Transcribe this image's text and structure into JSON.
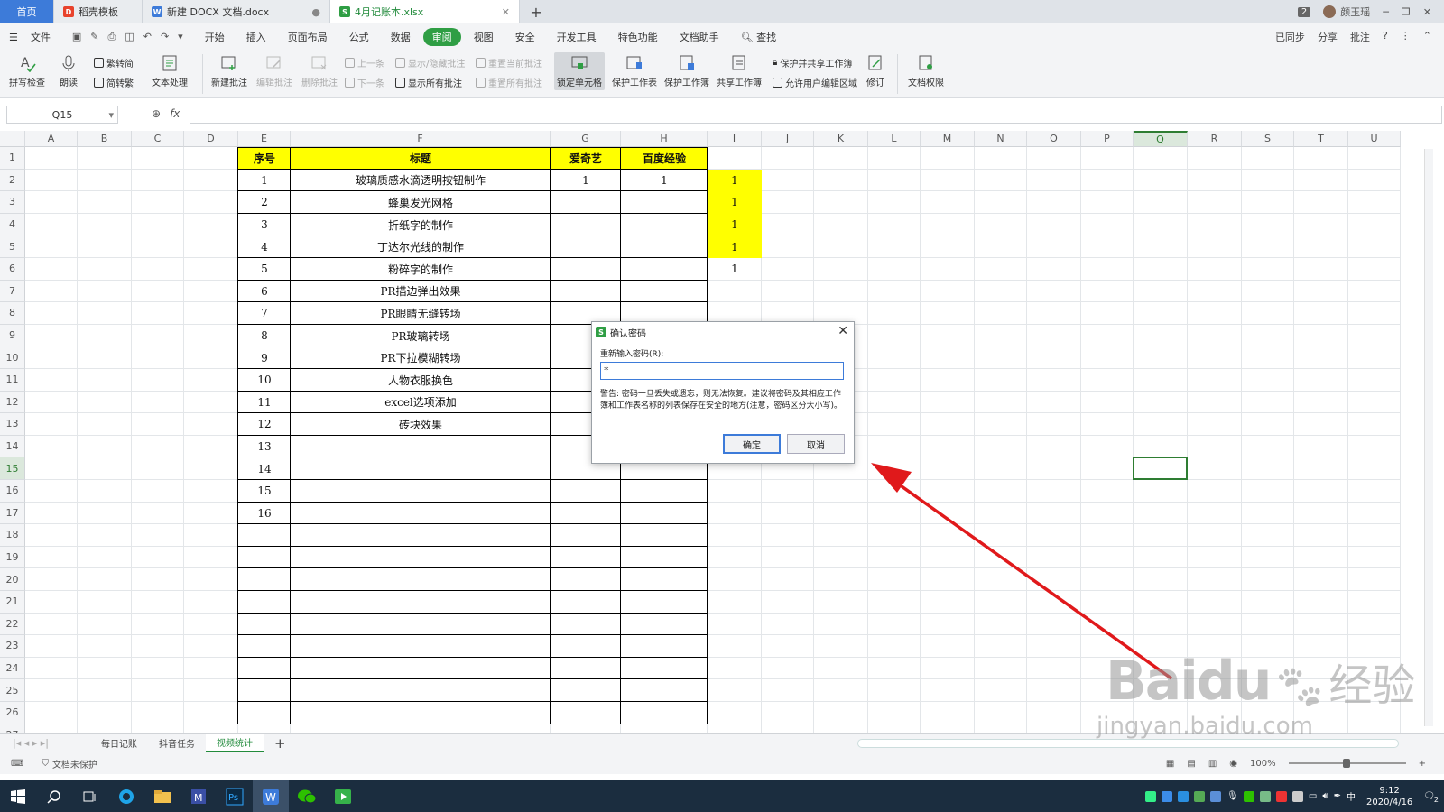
{
  "tabs": {
    "home": "首页",
    "items": [
      {
        "label": "稻壳模板"
      },
      {
        "label": "新建 DOCX 文档.docx"
      },
      {
        "label": "4月记账本.xlsx"
      }
    ],
    "badge": "2",
    "user": "颜玉瑶"
  },
  "menu": {
    "file": "文件",
    "items": [
      "开始",
      "插入",
      "页面布局",
      "公式",
      "数据",
      "审阅",
      "视图",
      "安全",
      "开发工具",
      "特色功能",
      "文档助手"
    ],
    "search": "查找",
    "right": [
      "已同步",
      "分享",
      "批注"
    ]
  },
  "ribbon": {
    "spell": "拼写检查",
    "read": "朗读",
    "trad": "繁转简",
    "simp": "简转繁",
    "textproc": "文本处理",
    "newcomment": "新建批注",
    "editcomment": "编辑批注",
    "delcomment": "删除批注",
    "prev": "上一条",
    "next": "下一条",
    "showhide": "显示/隐藏批注",
    "showall": "显示所有批注",
    "resetcur": "重置当前批注",
    "resetall": "重置所有批注",
    "lockcell": "锁定单元格",
    "protectsheet": "保护工作表",
    "protectbook": "保护工作簿",
    "sharebook": "共享工作簿",
    "protectshare": "保护并共享工作簿",
    "allowedit": "允许用户编辑区域",
    "revise": "修订",
    "docperm": "文档权限"
  },
  "formula": {
    "namebox": "Q15",
    "fx": "fx",
    "value": ""
  },
  "sheet": {
    "columns": [
      "A",
      "B",
      "C",
      "D",
      "E",
      "F",
      "G",
      "H",
      "I",
      "J",
      "K",
      "L",
      "M",
      "N",
      "O",
      "P",
      "Q",
      "R",
      "S",
      "T",
      "U"
    ],
    "rows": [
      "1",
      "2",
      "3",
      "4",
      "5",
      "6",
      "7",
      "8",
      "9",
      "10",
      "11",
      "12",
      "13",
      "14",
      "15",
      "16",
      "17",
      "18",
      "19",
      "20",
      "21",
      "22",
      "23",
      "24",
      "25",
      "26",
      "27"
    ],
    "headers": {
      "seq": "序号",
      "title": "标题",
      "iqiyi": "爱奇艺",
      "baidu": "百度经验"
    },
    "records": [
      {
        "seq": "1",
        "title": "玻璃质感水滴透明按钮制作",
        "iqiyi": "1",
        "baidu": "1",
        "i": "1"
      },
      {
        "seq": "2",
        "title": "蜂巢发光网格",
        "iqiyi": "",
        "baidu": "",
        "i": "1"
      },
      {
        "seq": "3",
        "title": "折纸字的制作",
        "iqiyi": "",
        "baidu": "",
        "i": "1"
      },
      {
        "seq": "4",
        "title": "丁达尔光线的制作",
        "iqiyi": "",
        "baidu": "",
        "i": "1"
      },
      {
        "seq": "5",
        "title": "粉碎字的制作",
        "iqiyi": "",
        "baidu": "",
        "i": "1"
      },
      {
        "seq": "6",
        "title": "PR描边弹出效果",
        "iqiyi": "",
        "baidu": "",
        "i": ""
      },
      {
        "seq": "7",
        "title": "PR眼睛无缝转场",
        "iqiyi": "",
        "baidu": "",
        "i": ""
      },
      {
        "seq": "8",
        "title": "PR玻璃转场",
        "iqiyi": "",
        "baidu": "",
        "i": ""
      },
      {
        "seq": "9",
        "title": "PR下拉模糊转场",
        "iqiyi": "",
        "baidu": "",
        "i": ""
      },
      {
        "seq": "10",
        "title": "人物衣服换色",
        "iqiyi": "",
        "baidu": "",
        "i": ""
      },
      {
        "seq": "11",
        "title": "excel选项添加",
        "iqiyi": "",
        "baidu": "",
        "i": ""
      },
      {
        "seq": "12",
        "title": "砖块效果",
        "iqiyi": "",
        "baidu": "",
        "i": ""
      },
      {
        "seq": "13",
        "title": "",
        "iqiyi": "",
        "baidu": "",
        "i": ""
      },
      {
        "seq": "14",
        "title": "",
        "iqiyi": "",
        "baidu": "",
        "i": ""
      },
      {
        "seq": "15",
        "title": "",
        "iqiyi": "",
        "baidu": "",
        "i": ""
      },
      {
        "seq": "16",
        "title": "",
        "iqiyi": "",
        "baidu": "",
        "i": ""
      }
    ],
    "selected_cell": "Q15",
    "header_fill": "#ffff00",
    "highlight_fill": "#ffff00"
  },
  "sheet_tabs": [
    "每日记账",
    "抖音任务",
    "视频统计"
  ],
  "active_sheet": "视频统计",
  "status": {
    "protect": "文档未保护",
    "zoom": "100%"
  },
  "dialog": {
    "title": "确认密码",
    "label": "重新输入密码(R):",
    "value": "*",
    "warning": "警告: 密码一旦丢失或遗忘，则无法恢复。建议将密码及其相应工作簿和工作表名称的列表保存在安全的地方(注意，密码区分大小写)。",
    "ok": "确定",
    "cancel": "取消"
  },
  "taskbar": {
    "time": "9:12",
    "date": "2020/4/16",
    "lang": "中",
    "notif": "2"
  },
  "watermark": {
    "brand": "Baidu",
    "brand2": "经验",
    "url": "jingyan.baidu.com"
  },
  "colors": {
    "accent": "#2f9e44",
    "arrow": "#e0191b",
    "tabhome": "#3d7bd9"
  }
}
